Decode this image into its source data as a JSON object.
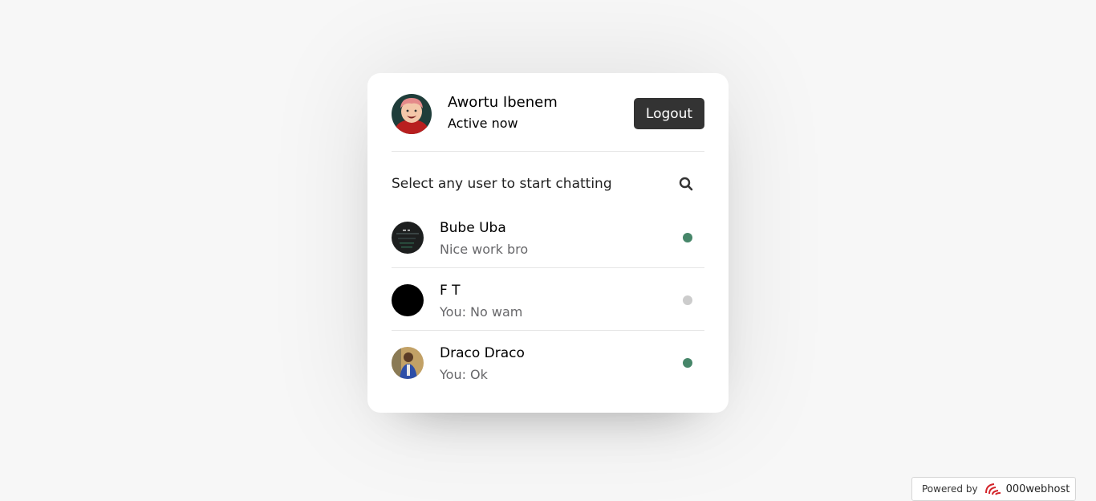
{
  "current_user": {
    "name": "Awortu Ibenem",
    "status": "Active now",
    "avatar_icon": "profile-photo-anime"
  },
  "header": {
    "logout_label": "Logout"
  },
  "search": {
    "prompt": "Select any user to start chatting",
    "icon": "search-icon"
  },
  "users": [
    {
      "name": "Bube Uba",
      "last_message": "Nice work bro",
      "online": true,
      "avatar": "dark-photo"
    },
    {
      "name": "F T",
      "last_message": "You: No wam",
      "online": false,
      "avatar": "black-circle"
    },
    {
      "name": "Draco Draco",
      "last_message": "You: Ok",
      "online": true,
      "avatar": "person-photo"
    }
  ],
  "footer": {
    "powered_by": "Powered by",
    "brand": "000webhost"
  },
  "colors": {
    "online": "#468669",
    "offline": "#cccccc",
    "button_bg": "#333333",
    "background": "#f7f7f7"
  }
}
